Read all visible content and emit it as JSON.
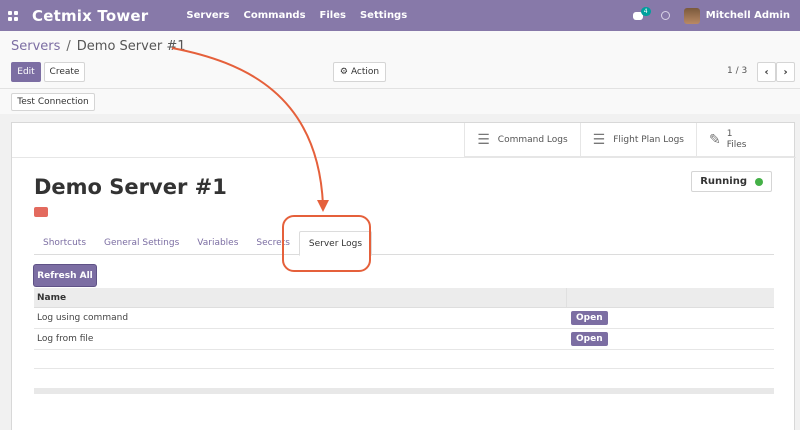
{
  "navbar": {
    "brand": "Cetmix Tower",
    "menu": [
      "Servers",
      "Commands",
      "Files",
      "Settings"
    ],
    "chat_badge": "4",
    "user_name": "Mitchell Admin"
  },
  "breadcrumb": {
    "parent": "Servers",
    "separator": "/",
    "current": "Demo Server #1"
  },
  "control_panel": {
    "edit_label": "Edit",
    "create_label": "Create",
    "action_label": "Action",
    "pager": "1 / 3",
    "prev": "‹",
    "next": "›"
  },
  "test_connection_label": "Test Connection",
  "button_box": {
    "command_logs": "Command Logs",
    "flight_plan_logs": "Flight Plan Logs",
    "files_count": "1",
    "files_label": "Files"
  },
  "record": {
    "title": "Demo Server #1",
    "status": "Running"
  },
  "tabs": [
    {
      "label": "Shortcuts"
    },
    {
      "label": "General Settings"
    },
    {
      "label": "Variables"
    },
    {
      "label": "Secrets"
    },
    {
      "label": "Server Logs"
    }
  ],
  "server_logs": {
    "refresh_label": "Refresh All",
    "header_name": "Name",
    "rows": [
      {
        "name": "Log using command",
        "action": "Open"
      },
      {
        "name": "Log from file",
        "action": "Open"
      }
    ]
  },
  "colors": {
    "navbar": "#8779a9",
    "primary": "#7c6ea3",
    "annotation": "#e5603b",
    "status_running": "#44b047",
    "color_tag": "#e36a5e"
  }
}
